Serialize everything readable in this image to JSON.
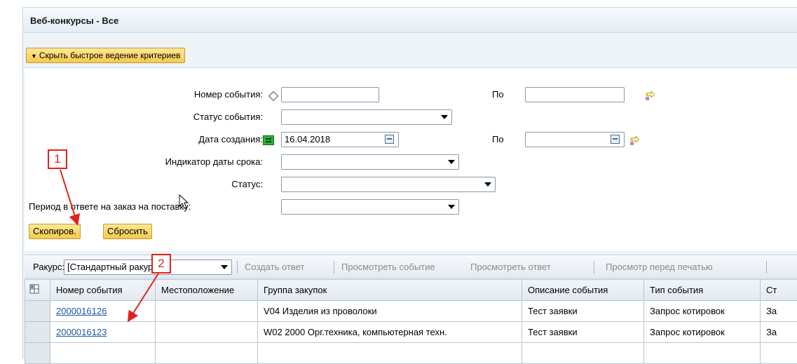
{
  "panel": {
    "title": "Веб-конкурсы - Все"
  },
  "criteria": {
    "toggle_label": "Скрыть быстрое ведение критериев",
    "event_number_label": "Номер события:",
    "event_number_value": "",
    "to_label": "По",
    "event_number_to_value": "",
    "event_status_label": "Статус события:",
    "event_status_value": "",
    "created_date_label": "Дата создания:",
    "created_date_value": "16.04.2018",
    "created_date_to_value": "",
    "due_date_indicator_label": "Индикатор даты срока:",
    "due_date_indicator_value": "",
    "status_label": "Статус:",
    "status_value": "",
    "response_period_label": "Период в ответе на заказ на поставку:",
    "response_period_value": "",
    "copy_button": "Скопиров.",
    "reset_button": "Сбросить"
  },
  "toolbar": {
    "view_label": "Ракурс:",
    "view_value": "[Стандартный ракурс",
    "create_response": "Создать ответ",
    "view_event": "Просмотреть событие",
    "view_response": "Просмотреть ответ",
    "print_preview": "Просмотр перед печатью"
  },
  "table": {
    "columns": [
      "Номер события",
      "Местоположение",
      "Группа закупок",
      "Описание события",
      "Тип события",
      "Ст"
    ],
    "rows": [
      [
        "2000016126",
        "",
        "V04 Изделия из проволоки",
        "Тест заявки",
        "Запрос котировок",
        "За"
      ],
      [
        "2000016123",
        "",
        "W02 2000 Орг.техника, компьютерная техн.",
        "Тест заявки",
        "Запрос котировок",
        "За"
      ]
    ]
  },
  "annotations": {
    "callout_1": "1",
    "callout_2": "2"
  },
  "colors": {
    "callout": "#e0221c",
    "button": "#f6c94a",
    "link": "#1b58a8",
    "panel": "#eef3f8"
  },
  "icons": [
    "caret-down-icon",
    "diamond-operator-icon",
    "equal-operator-icon",
    "calendar-icon",
    "yellow-arrow-icon",
    "table-settings-icon",
    "dropdown-arrow-icon"
  ]
}
